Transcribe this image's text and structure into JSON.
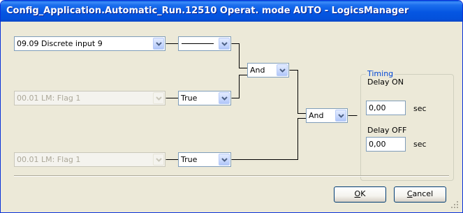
{
  "window": {
    "title": "Config_Application.Automatic_Run.12510 Operat. mode AUTO - LogicsManager"
  },
  "inputs": [
    {
      "command": "09.09 Discrete input 9",
      "operator": "",
      "enabled": true
    },
    {
      "command": "00.01 LM: Flag 1",
      "operator": "True",
      "enabled": false
    },
    {
      "command": "00.01 LM: Flag 1",
      "operator": "True",
      "enabled": false
    }
  ],
  "gates": {
    "gate1": "And",
    "gate2": "And"
  },
  "timing": {
    "title": "Timing",
    "delay_on_label": "Delay ON",
    "delay_on_value": "0,00",
    "delay_on_unit": "sec",
    "delay_off_label": "Delay OFF",
    "delay_off_value": "0,00",
    "delay_off_unit": "sec"
  },
  "buttons": {
    "ok_accel": "O",
    "ok_rest": "K",
    "cancel_accel": "C",
    "cancel_rest": "ancel"
  },
  "colors": {
    "titlebar": "#0A5FE4",
    "dialog_bg": "#ECE9D8",
    "group_title": "#0046D5"
  }
}
